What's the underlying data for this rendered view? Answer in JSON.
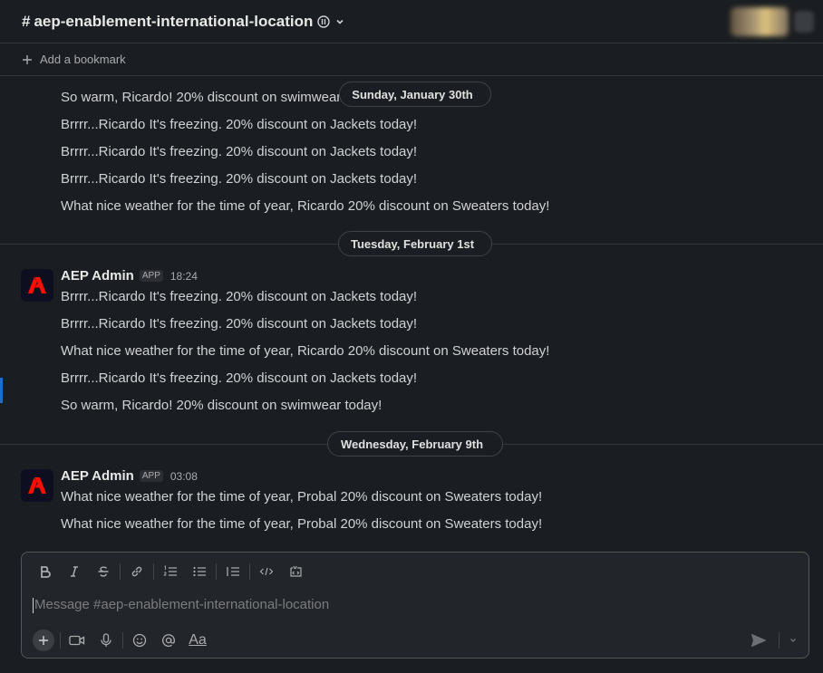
{
  "header": {
    "hash": "#",
    "channel_name": "aep-enablement-international-location"
  },
  "bookmark": {
    "label": "Add a bookmark"
  },
  "top_messages": [
    "So warm, Ricardo! 20% discount on swimwear t",
    "Brrrr...Ricardo It's freezing. 20% discount on Jackets today!",
    "Brrrr...Ricardo It's freezing. 20% discount on Jackets today!",
    "Brrrr...Ricardo It's freezing. 20% discount on Jackets today!",
    "What nice weather for the time of year, Ricardo 20% discount on Sweaters today!"
  ],
  "dates": {
    "jan30": "Sunday, January 30th",
    "feb1": "Tuesday, February 1st",
    "feb9": "Wednesday, February 9th"
  },
  "group1": {
    "sender": "AEP Admin",
    "badge": "APP",
    "time": "18:24",
    "messages": [
      "Brrrr...Ricardo It's freezing. 20% discount on Jackets today!",
      "Brrrr...Ricardo It's freezing. 20% discount on Jackets today!",
      "What nice weather for the time of year, Ricardo 20% discount on Sweaters today!",
      "Brrrr...Ricardo It's freezing. 20% discount on Jackets today!",
      "So warm, Ricardo! 20% discount on swimwear today!"
    ]
  },
  "group2": {
    "sender": "AEP Admin",
    "badge": "APP",
    "time": "03:08",
    "messages": [
      "What nice weather for the time of year, Probal 20% discount on Sweaters today!",
      "What nice weather for the time of year, Probal 20% discount on Sweaters today!"
    ]
  },
  "composer": {
    "placeholder": "Message #aep-enablement-international-location",
    "format_label": "Aa"
  },
  "colors": {
    "background": "#1a1d21",
    "adobe_red": "#fa0f00",
    "accent_blue": "#1d6fc7"
  }
}
